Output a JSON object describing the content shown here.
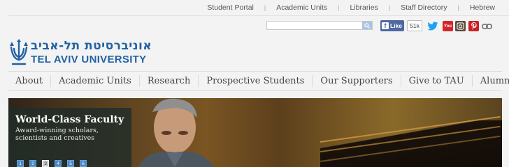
{
  "utility_links": [
    "Student Portal",
    "Academic Units",
    "Libraries",
    "Staff Directory",
    "Hebrew"
  ],
  "utility_separator": "|",
  "search": {
    "placeholder": ""
  },
  "facebook": {
    "icon": "f",
    "like_label": "Like",
    "count": "51k"
  },
  "social_icons": [
    "twitter-icon",
    "youtube-icon",
    "instagram-icon",
    "pinterest-icon",
    "link-icon"
  ],
  "youtube_label": "You",
  "logo": {
    "hebrew": "אוניברסיטת תל-אביב",
    "english": "TEL AVIV UNIVERSITY"
  },
  "nav": [
    "About",
    "Academic Units",
    "Research",
    "Prospective Students",
    "Our Supporters",
    "Give to TAU",
    "Alumni"
  ],
  "hero": {
    "title": "World-Class Faculty",
    "subtitle": "Award-winning scholars, scientists and creatives",
    "slides": [
      "1",
      "2",
      "3",
      "4",
      "5",
      "6"
    ],
    "active_slide": 3
  },
  "colors": {
    "brand_blue": "#2163a4",
    "facebook": "#4e69a2",
    "caption_bg": "#212d2a"
  }
}
